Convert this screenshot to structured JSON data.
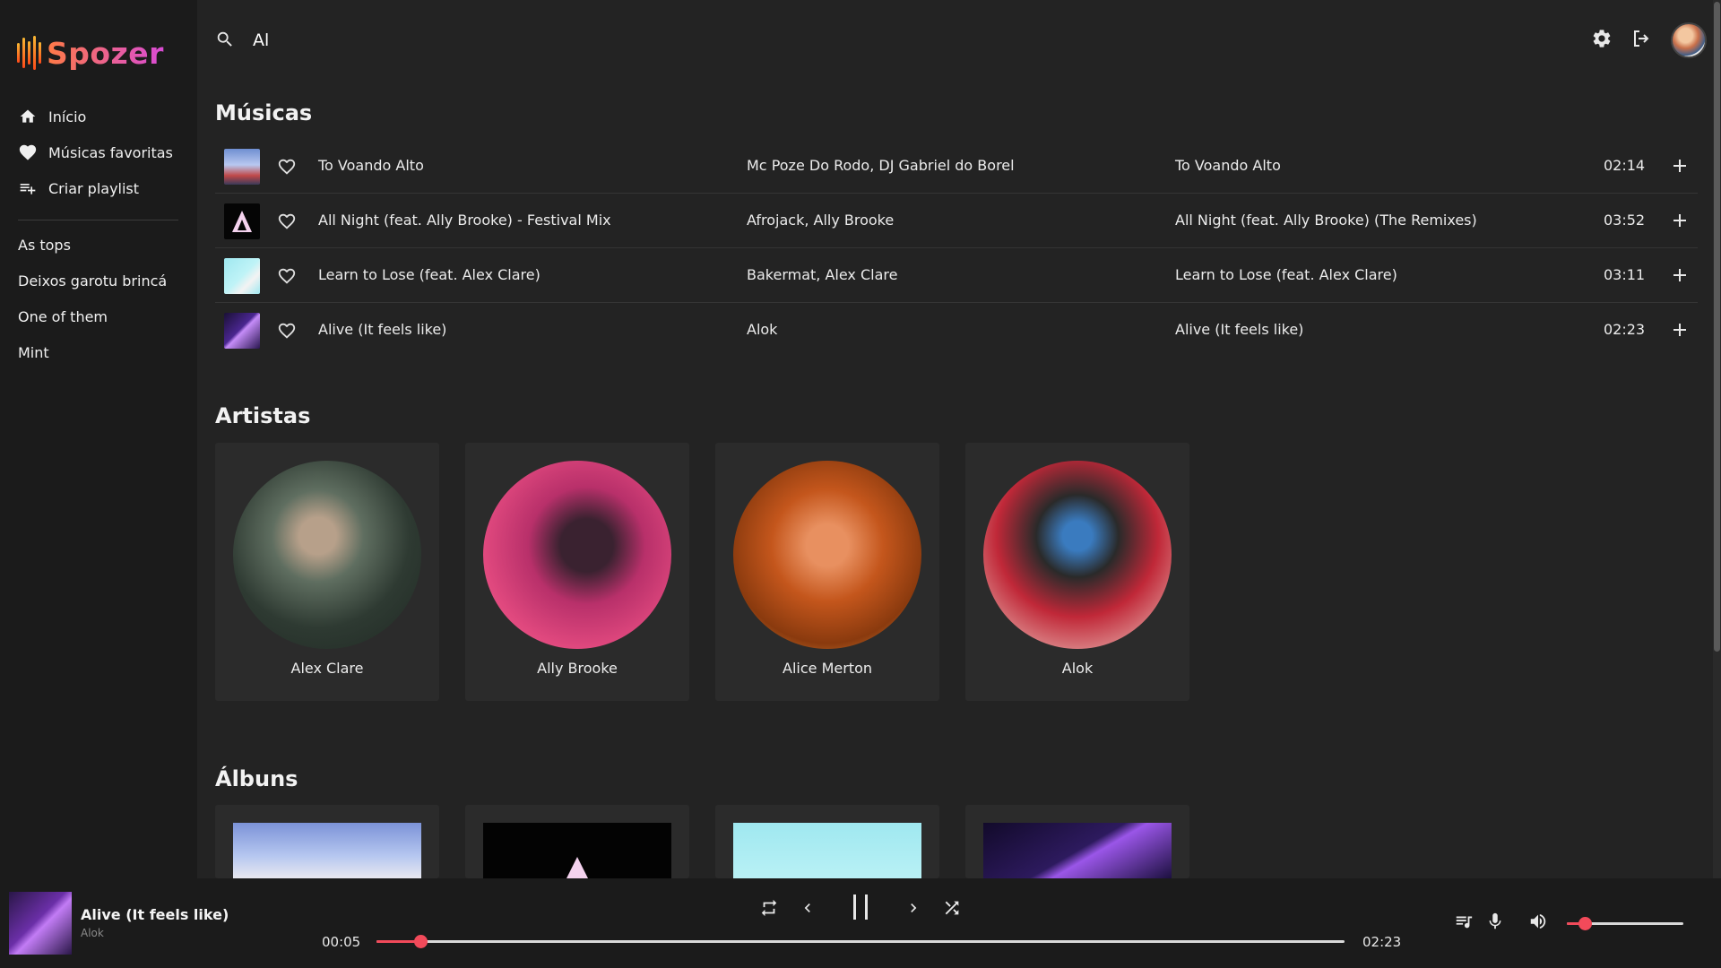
{
  "app": {
    "name": "Spozer"
  },
  "sidebar": {
    "nav": [
      {
        "label": "Início",
        "icon": "home-icon"
      },
      {
        "label": "Músicas favoritas",
        "icon": "heart-icon"
      },
      {
        "label": "Criar playlist",
        "icon": "playlist-add-icon"
      }
    ],
    "playlists": [
      "As tops",
      "Deixos garotu brincá",
      "One of them",
      "Mint"
    ]
  },
  "search": {
    "value": "Al",
    "icon": "search-icon"
  },
  "header": {
    "settings_icon": "gear-icon",
    "logout_icon": "logout-icon"
  },
  "sections": {
    "songs": "Músicas",
    "artists": "Artistas",
    "albums": "Álbuns"
  },
  "tracks": [
    {
      "title": "To Voando Alto",
      "artists": "Mc Poze Do Rodo, DJ Gabriel do Borel",
      "album": "To Voando Alto",
      "duration": "02:14"
    },
    {
      "title": "All Night (feat. Ally Brooke) - Festival Mix",
      "artists": "Afrojack, Ally Brooke",
      "album": "All Night (feat. Ally Brooke) (The Remixes)",
      "duration": "03:52"
    },
    {
      "title": "Learn to Lose (feat. Alex Clare)",
      "artists": "Bakermat, Alex Clare",
      "album": "Learn to Lose (feat. Alex Clare)",
      "duration": "03:11"
    },
    {
      "title": "Alive (It feels like)",
      "artists": "Alok",
      "album": "Alive (It feels like)",
      "duration": "02:23"
    }
  ],
  "artists": [
    "Alex Clare",
    "Ally Brooke",
    "Alice Merton",
    "Alok"
  ],
  "player": {
    "title": "Alive (It feels like)",
    "artist": "Alok",
    "elapsed": "00:05",
    "total": "02:23",
    "progress": 0.045,
    "volume": 0.15
  },
  "colors": {
    "accent": "#f24a5a",
    "background": "#232323",
    "sidebar": "#1b1b1b"
  }
}
